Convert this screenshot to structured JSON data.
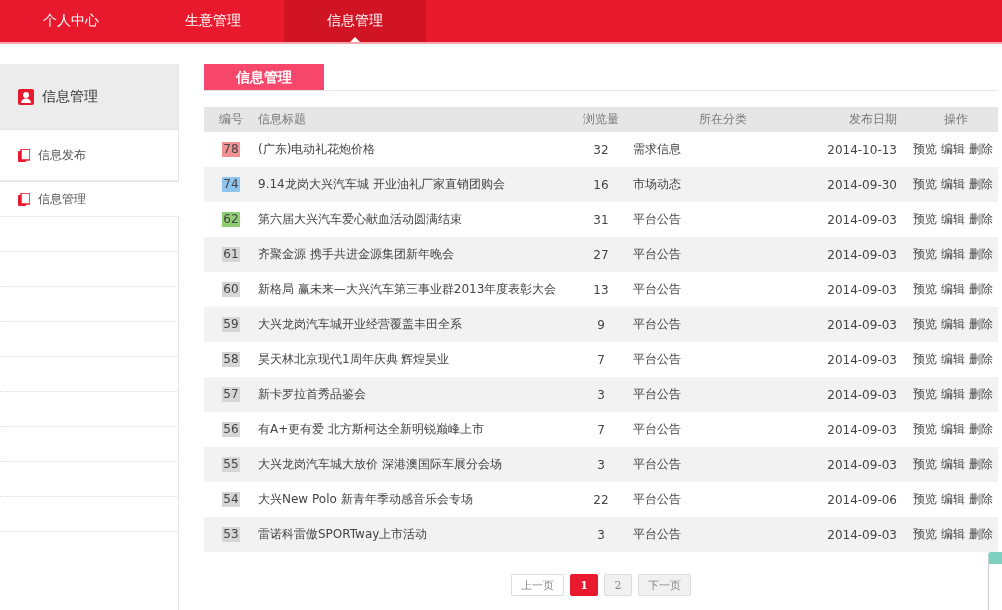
{
  "nav_tabs": [
    {
      "label": "个人中心",
      "selected": false
    },
    {
      "label": "生意管理",
      "selected": false
    },
    {
      "label": "信息管理",
      "selected": true
    }
  ],
  "sidebar": {
    "title": "信息管理",
    "items": [
      {
        "label": "信息发布",
        "selected": false
      },
      {
        "label": "信息管理",
        "selected": true
      }
    ]
  },
  "panel": {
    "title": "信息管理"
  },
  "table": {
    "columns": [
      "编号",
      "信息标题",
      "浏览量",
      "所在分类",
      "发布日期",
      "操作"
    ],
    "rows": [
      {
        "id": "78",
        "color": "#f29191",
        "title": "(广东)电动礼花炮价格",
        "views": "32",
        "category": "需求信息",
        "date": "2014-10-13",
        "actions": [
          "预览",
          "编辑",
          "删除"
        ]
      },
      {
        "id": "74",
        "color": "#8ec5ee",
        "title": "9.14龙岗大兴汽车城 开业油礼厂家直销团购会",
        "views": "16",
        "category": "市场动态",
        "date": "2014-09-30",
        "actions": [
          "预览",
          "编辑",
          "删除"
        ]
      },
      {
        "id": "62",
        "color": "#8fcd72",
        "title": "第六届大兴汽车爱心献血活动圆满结束",
        "views": "31",
        "category": "平台公告",
        "date": "2014-09-03",
        "actions": [
          "预览",
          "编辑",
          "删除"
        ]
      },
      {
        "id": "61",
        "color": "#d6d6d6",
        "title": "齐聚金源 携手共进金源集团新年晚会",
        "views": "27",
        "category": "平台公告",
        "date": "2014-09-03",
        "actions": [
          "预览",
          "编辑",
          "删除"
        ]
      },
      {
        "id": "60",
        "color": "#d6d6d6",
        "title": "新格局 赢未来—大兴汽车第三事业群2013年度表彰大会",
        "views": "13",
        "category": "平台公告",
        "date": "2014-09-03",
        "actions": [
          "预览",
          "编辑",
          "删除"
        ]
      },
      {
        "id": "59",
        "color": "#d6d6d6",
        "title": "大兴龙岗汽车城开业经营覆盖丰田全系",
        "views": "9",
        "category": "平台公告",
        "date": "2014-09-03",
        "actions": [
          "预览",
          "编辑",
          "删除"
        ]
      },
      {
        "id": "58",
        "color": "#d6d6d6",
        "title": "昊天林北京现代1周年庆典 辉煌昊业",
        "views": "7",
        "category": "平台公告",
        "date": "2014-09-03",
        "actions": [
          "预览",
          "编辑",
          "删除"
        ]
      },
      {
        "id": "57",
        "color": "#d6d6d6",
        "title": "新卡罗拉首秀品鉴会",
        "views": "3",
        "category": "平台公告",
        "date": "2014-09-03",
        "actions": [
          "预览",
          "编辑",
          "删除"
        ]
      },
      {
        "id": "56",
        "color": "#d6d6d6",
        "title": "有A+更有爱 北方斯柯达全新明锐巅峰上市",
        "views": "7",
        "category": "平台公告",
        "date": "2014-09-03",
        "actions": [
          "预览",
          "编辑",
          "删除"
        ]
      },
      {
        "id": "55",
        "color": "#d6d6d6",
        "title": "大兴龙岗汽车城大放价 深港澳国际车展分会场",
        "views": "3",
        "category": "平台公告",
        "date": "2014-09-03",
        "actions": [
          "预览",
          "编辑",
          "删除"
        ]
      },
      {
        "id": "54",
        "color": "#d6d6d6",
        "title": "大兴New Polo 新青年季动感音乐会专场",
        "views": "22",
        "category": "平台公告",
        "date": "2014-09-06",
        "actions": [
          "预览",
          "编辑",
          "删除"
        ]
      },
      {
        "id": "53",
        "color": "#d6d6d6",
        "title": "雷诺科雷傲SPORTway上市活动",
        "views": "3",
        "category": "平台公告",
        "date": "2014-09-03",
        "actions": [
          "预览",
          "编辑",
          "删除"
        ]
      }
    ]
  },
  "pagination": {
    "prev": "上一页",
    "pages": [
      {
        "label": "1",
        "selected": true
      },
      {
        "label": "2",
        "selected": false
      }
    ],
    "next": "下一页"
  }
}
